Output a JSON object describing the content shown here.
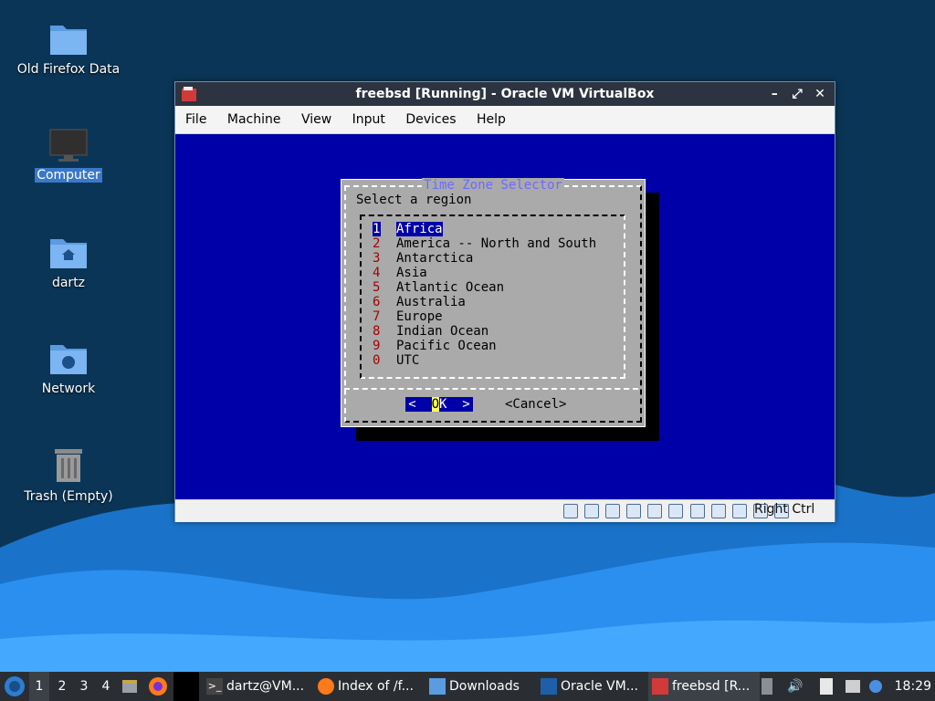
{
  "desktop": {
    "icons": [
      {
        "label": "Old Firefox Data",
        "icon": "folder-icon"
      },
      {
        "label": "Computer",
        "icon": "monitor-icon",
        "selected": true
      },
      {
        "label": "dartz",
        "icon": "home-folder-icon"
      },
      {
        "label": "Network",
        "icon": "network-folder-icon"
      },
      {
        "label": "Trash (Empty)",
        "icon": "trash-icon"
      }
    ]
  },
  "window": {
    "title": "freebsd [Running] - Oracle VM VirtualBox",
    "controls": {
      "minimize": "–",
      "restore": "⤢",
      "close": "✕"
    },
    "menu": [
      "File",
      "Machine",
      "View",
      "Input",
      "Devices",
      "Help"
    ],
    "host_key": "Right Ctrl"
  },
  "dialog": {
    "title": "Time Zone Selector",
    "prompt": "Select a region",
    "regions": [
      {
        "num": "1",
        "name": "Africa"
      },
      {
        "num": "2",
        "name": "America -- North and South"
      },
      {
        "num": "3",
        "name": "Antarctica"
      },
      {
        "num": "4",
        "name": "Asia"
      },
      {
        "num": "5",
        "name": "Atlantic Ocean"
      },
      {
        "num": "6",
        "name": "Australia"
      },
      {
        "num": "7",
        "name": "Europe"
      },
      {
        "num": "8",
        "name": "Indian Ocean"
      },
      {
        "num": "9",
        "name": "Pacific Ocean"
      },
      {
        "num": "0",
        "name": "UTC"
      }
    ],
    "selected_index": 0,
    "ok": {
      "left": "<  ",
      "hot": "O",
      "rest": "K  >"
    },
    "cancel": "<Cancel>"
  },
  "taskbar": {
    "workspaces": [
      "1",
      "2",
      "3",
      "4"
    ],
    "active_workspace": "1",
    "tasks": [
      {
        "label": "dartz@VM...",
        "icon": "terminal-icon"
      },
      {
        "label": "Index of /f...",
        "icon": "firefox-icon"
      },
      {
        "label": "Downloads",
        "icon": "folder-icon"
      },
      {
        "label": "Oracle VM...",
        "icon": "virtualbox-icon"
      },
      {
        "label": "freebsd [R...",
        "icon": "virtualbox-vm-icon",
        "active": true
      }
    ],
    "clock": "18:29"
  }
}
